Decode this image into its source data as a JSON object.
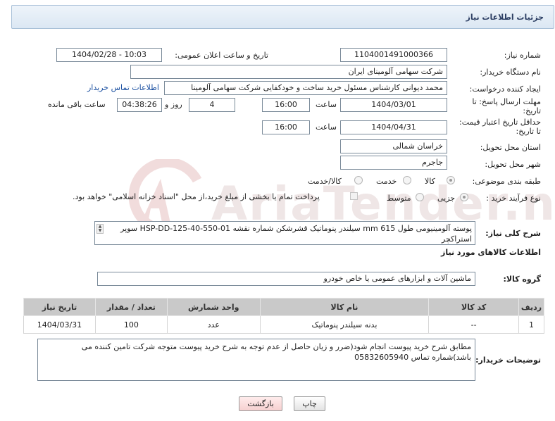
{
  "header": {
    "title": "جزئیات اطلاعات نیاز"
  },
  "fields": {
    "need_number_label": "شماره نیاز:",
    "need_number": "1104001491000366",
    "announce_label": "تاریخ و ساعت اعلان عمومی:",
    "announce_value": "1404/02/28 - 10:03",
    "buyer_label": "نام دستگاه خریدار:",
    "buyer_value": "شرکت سهامی آلومینای ایران",
    "creator_label": "ایجاد کننده درخواست:",
    "creator_value": "محمد دیوانی کارشناس مسئول خرید ساخت و خودکفایی شرکت سهامی آلومینا",
    "contact_link": "اطلاعات تماس خریدار",
    "deadline_label_1": "مهلت ارسال پاسخ: تا",
    "deadline_label_2": "تاریخ:",
    "deadline_date": "1404/03/01",
    "time_label": "ساعت",
    "deadline_time": "16:00",
    "days_value": "4",
    "days_label": "روز و",
    "remaining_time": "04:38:26",
    "remaining_label": "ساعت باقی مانده",
    "validity_label_1": "حداقل تاریخ اعتبار قیمت:",
    "validity_label_2": "تا تاریخ:",
    "validity_date": "1404/04/31",
    "validity_time": "16:00",
    "province_label": "استان محل تحویل:",
    "province_value": "خراسان شمالی",
    "city_label": "شهر محل تحویل:",
    "city_value": "جاجرم",
    "category_label": "طبقه بندی موضوعی:",
    "category_options": [
      "کالا",
      "خدمت",
      "کالا/خدمت"
    ],
    "process_label": "نوع فرآیند خرید :",
    "process_options": [
      "جزیی",
      "متوسط"
    ],
    "payment_note": "پرداخت تمام یا بخشی از مبلغ خرید،از محل \"اسناد خزانه اسلامی\" خواهد بود.",
    "description_label": "شرح کلی نیاز:",
    "description_value": "پوسته آلومینیومی طول 615 mm سیلندر پنوماتیک قشرشکن شماره نقشه HSP-DD-125-40-550-01 سوپر استراکچر",
    "goods_info_title": "اطلاعات کالاهای مورد نیاز",
    "goods_group_label": "گروه کالا:",
    "goods_group_value": "ماشین آلات و ابزارهای عمومی یا خاص خودرو",
    "buyer_notes_label": "توضیحات خریدار:",
    "buyer_notes_value": "مطابق شرح خرید پیوست انجام شود(ضرر و زیان حاصل از عدم توجه به شرح خرید پیوست متوجه شرکت تامین کننده می باشد)شماره تماس 05832605940"
  },
  "table": {
    "headers": [
      "ردیف",
      "کد کالا",
      "نام کالا",
      "واحد شمارش",
      "تعداد / مقدار",
      "تاریخ نیاز"
    ],
    "rows": [
      [
        "1",
        "--",
        "بدنه سیلندر پنوماتیک",
        "عدد",
        "100",
        "1404/03/31"
      ]
    ]
  },
  "buttons": {
    "print": "چاپ",
    "back": "بازگشت"
  },
  "watermark": {
    "text": "AriaTender.neT"
  },
  "colors": {
    "header_bg": "#dbe7f3",
    "link": "#1a4fa0",
    "table_header": "#c9c9c9",
    "back_button": "#f6d0d0"
  }
}
